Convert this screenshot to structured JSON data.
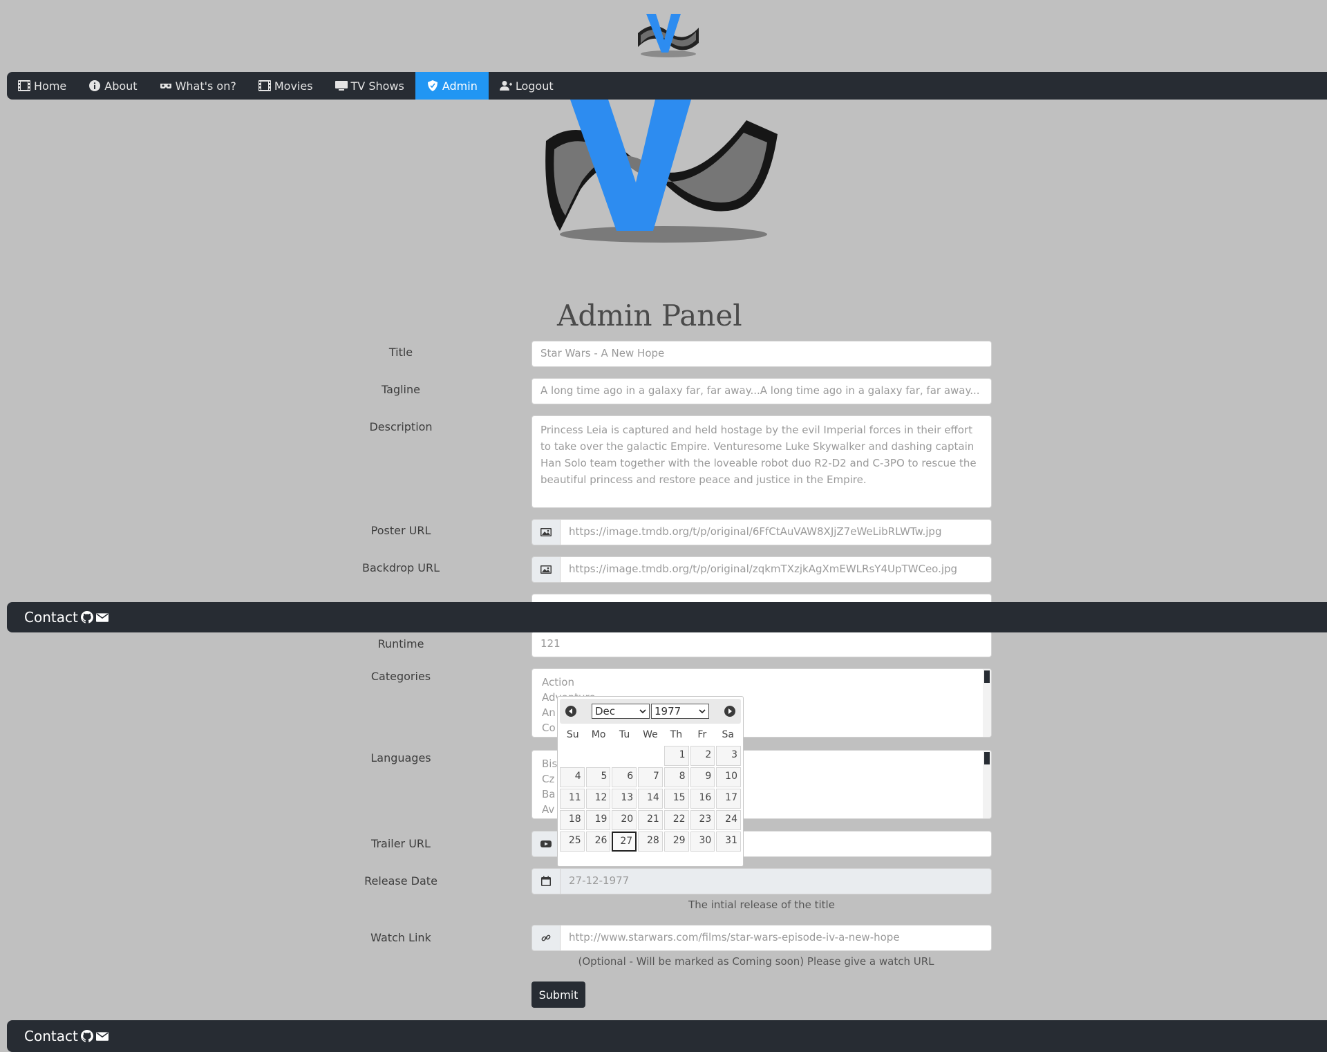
{
  "nav": {
    "items": [
      {
        "label": "Home",
        "icon": "film-icon"
      },
      {
        "label": "About",
        "icon": "info-icon"
      },
      {
        "label": "What's on?",
        "icon": "mask-icon"
      },
      {
        "label": "Movies",
        "icon": "film-icon"
      },
      {
        "label": "TV Shows",
        "icon": "tv-icon"
      },
      {
        "label": "Admin",
        "icon": "shield-icon",
        "active": true
      },
      {
        "label": "Logout",
        "icon": "user-icon"
      }
    ]
  },
  "page": {
    "title": "Admin Panel"
  },
  "form": {
    "title": {
      "label": "Title",
      "value": "Star Wars - A New Hope"
    },
    "tagline": {
      "label": "Tagline",
      "value": "A long time ago in a galaxy far, far away...A long time ago in a galaxy far, far away..."
    },
    "description": {
      "label": "Description",
      "value": "Princess Leia is captured and held hostage by the evil Imperial forces in their effort to take over the galactic Empire. Venturesome Luke Skywalker and dashing captain Han Solo team together with the loveable robot duo R2-D2 and C-3PO to rescue the beautiful princess and restore peace and justice in the Empire."
    },
    "poster_url": {
      "label": "Poster URL",
      "value": "https://image.tmdb.org/t/p/original/6FfCtAuVAW8XJjZ7eWeLibRLWTw.jpg"
    },
    "backdrop_url": {
      "label": "Backdrop URL",
      "value": "https://image.tmdb.org/t/p/original/zqkmTXzjkAgXmEWLRsY4UpTWCeo.jpg"
    },
    "runtime": {
      "label": "Runtime",
      "value": "121"
    },
    "categories": {
      "label": "Categories",
      "options": [
        "Action",
        "Adventure",
        "An",
        "Co"
      ]
    },
    "languages": {
      "label": "Languages",
      "options": [
        "Bis",
        "Cz",
        "Ba",
        "Av"
      ]
    },
    "trailer_url": {
      "label": "Trailer URL",
      "value": ""
    },
    "release_date": {
      "label": "Release Date",
      "value": "27-12-1977",
      "help": "The intial release of the title"
    },
    "watch_link": {
      "label": "Watch Link",
      "value": "http://www.starwars.com/films/star-wars-episode-iv-a-new-hope",
      "help": "(Optional - Will be marked as Coming soon) Please give a watch URL"
    },
    "submit_label": "Submit"
  },
  "contact": {
    "label": "Contact"
  },
  "datepicker": {
    "month": "Dec",
    "year": "1977",
    "weekdays": [
      "Su",
      "Mo",
      "Tu",
      "We",
      "Th",
      "Fr",
      "Sa"
    ],
    "days": [
      "",
      "",
      "",
      "",
      "1",
      "2",
      "3",
      "4",
      "5",
      "6",
      "7",
      "8",
      "9",
      "10",
      "11",
      "12",
      "13",
      "14",
      "15",
      "16",
      "17",
      "18",
      "19",
      "20",
      "21",
      "22",
      "23",
      "24",
      "25",
      "26",
      "27",
      "28",
      "29",
      "30",
      "31"
    ],
    "selected": "27"
  }
}
